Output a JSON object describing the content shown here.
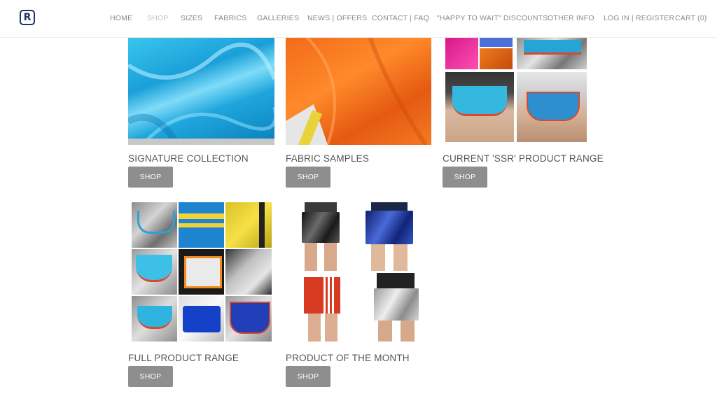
{
  "header": {
    "logo_letter": "R",
    "nav": [
      {
        "label": "HOME",
        "active": false
      },
      {
        "label": "SHOP",
        "active": true
      },
      {
        "label": "SIZES",
        "active": false
      },
      {
        "label": "FABRICS",
        "active": false
      },
      {
        "label": "GALLERIES",
        "active": false
      },
      {
        "label": "NEWS | OFFERS",
        "active": false
      },
      {
        "label": "CONTACT | FAQ",
        "active": false
      },
      {
        "label": "\"HAPPY TO WAIT\" DISCOUNTS",
        "active": false
      },
      {
        "label": "OTHER INFO",
        "active": false
      },
      {
        "label": "LOG IN | REGISTER",
        "active": false
      },
      {
        "label": "CART (0)",
        "active": false
      }
    ]
  },
  "products": [
    {
      "title": "SIGNATURE COLLECTION",
      "button": "SHOP"
    },
    {
      "title": "FABRIC SAMPLES",
      "button": "SHOP"
    },
    {
      "title": "CURRENT 'SSR' PRODUCT RANGE",
      "button": "SHOP"
    },
    {
      "title": "FULL PRODUCT RANGE",
      "button": "SHOP"
    },
    {
      "title": "PRODUCT OF THE MONTH",
      "button": "SHOP"
    }
  ],
  "colors": {
    "logo": "#1e3566",
    "button_bg": "#8e8e8e",
    "nav_text": "#8a8a8a",
    "nav_active": "#c4c4c4"
  }
}
